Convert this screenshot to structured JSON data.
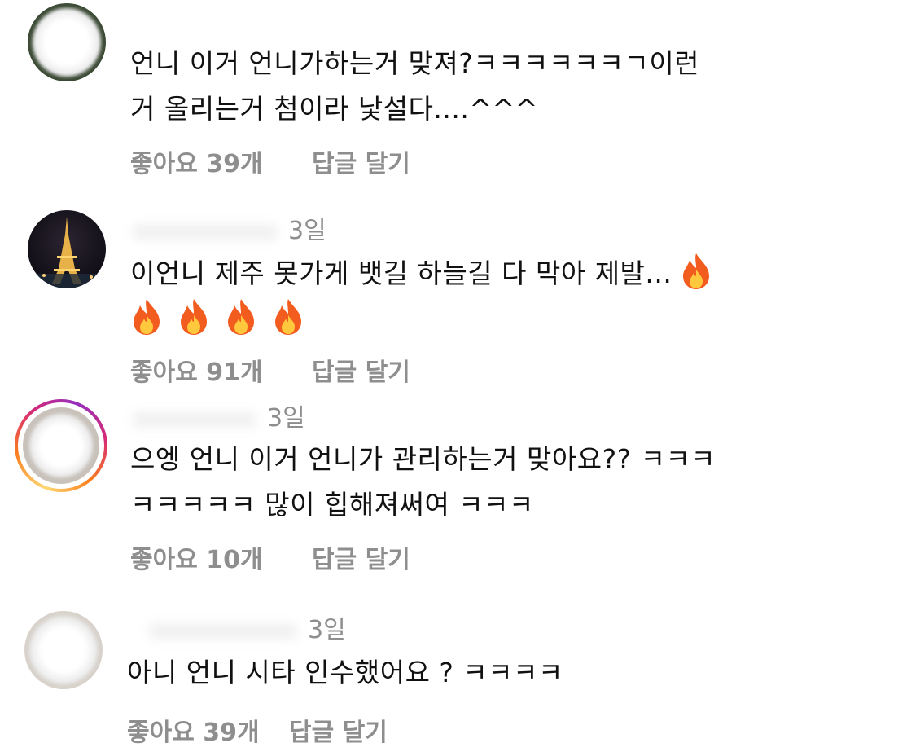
{
  "comments": [
    {
      "time": "",
      "lines": [
        "언니 이거 언니가하는거 맞져?ㅋㅋㅋㅋㅋㅋㄱ이런",
        "거 올리는거 첨이라 낯설다....^^^"
      ],
      "likes": "좋아요 39개",
      "reply": "답글 달기"
    },
    {
      "time": "3일",
      "lines": [
        "이언니 제주 못가게 뱃길 하늘길 다 막아 제발..."
      ],
      "likes": "좋아요 91개",
      "reply": "답글 달기",
      "emoji": "fire-icon"
    },
    {
      "time": "3일",
      "lines": [
        "으엥 언니 이거 언니가 관리하는거 맞아요?? ㅋㅋㅋ",
        "ㅋㅋㅋㅋㅋ 많이 힙해져써여 ㅋㅋㅋ"
      ],
      "likes": "좋아요 10개",
      "reply": "답글 달기",
      "story_ring": true
    },
    {
      "time": "3일",
      "lines": [
        "아니 언니 시타 인수했어요 ? ㅋㅋㅋㅋ"
      ],
      "likes": "좋아요 39개",
      "reply": "답글 달기"
    }
  ],
  "colors": {
    "meta": "#8e8e8e",
    "text": "#111111",
    "fire_outer": "#f25c1f",
    "fire_inner": "#ffc83d",
    "story_ring_start": "#feda75",
    "story_ring_end": "#d62976"
  }
}
